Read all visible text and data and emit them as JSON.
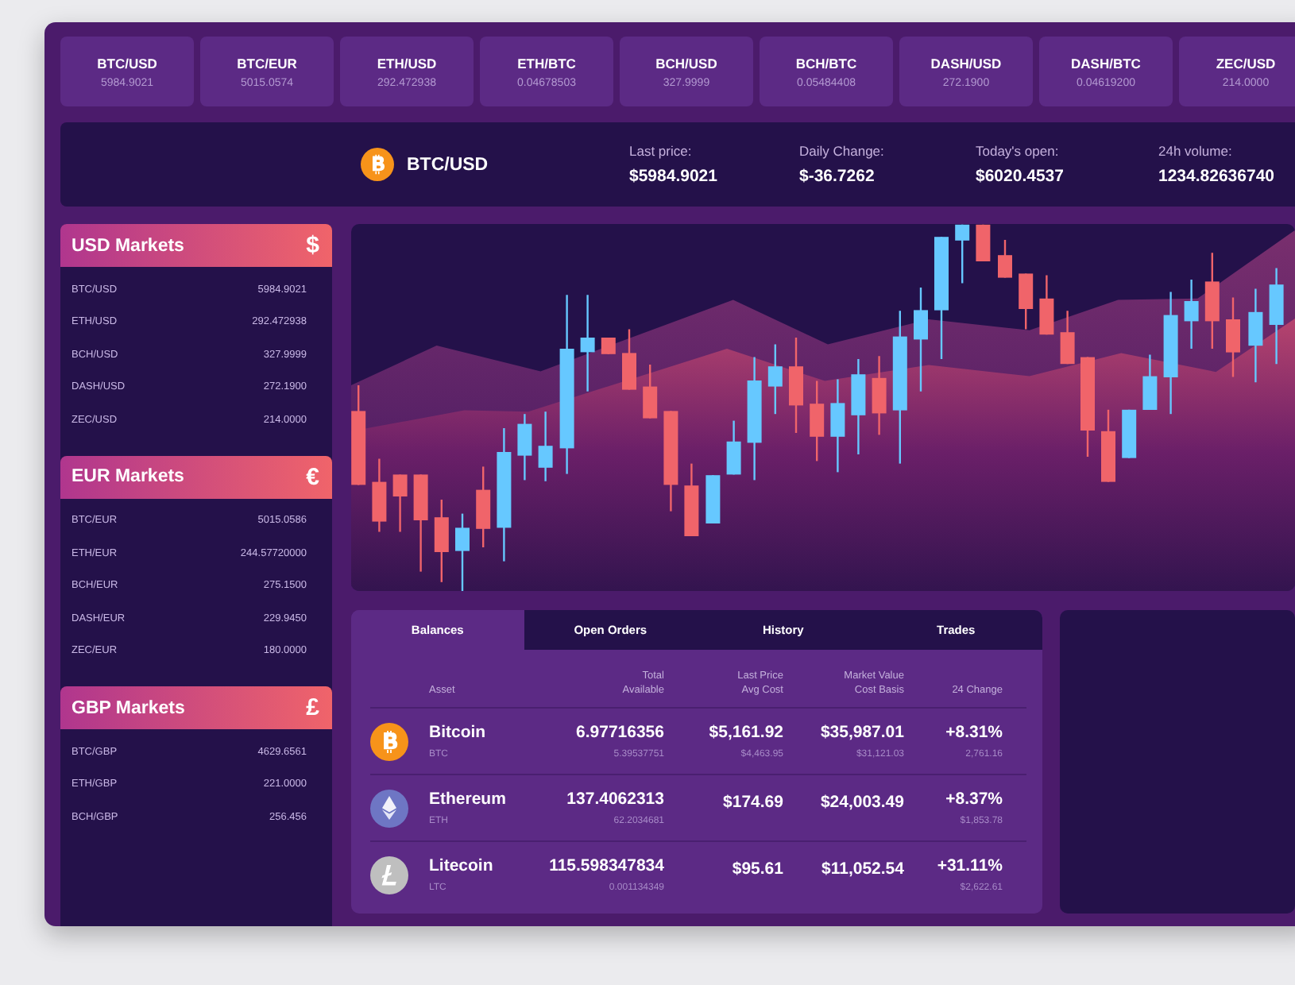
{
  "tickers": [
    {
      "pair": "BTC/USD",
      "price": "5984.9021"
    },
    {
      "pair": "BTC/EUR",
      "price": "5015.0574"
    },
    {
      "pair": "ETH/USD",
      "price": "292.472938"
    },
    {
      "pair": "ETH/BTC",
      "price": "0.04678503"
    },
    {
      "pair": "BCH/USD",
      "price": "327.9999"
    },
    {
      "pair": "BCH/BTC",
      "price": "0.05484408"
    },
    {
      "pair": "DASH/USD",
      "price": "272.1900"
    },
    {
      "pair": "DASH/BTC",
      "price": "0.04619200"
    },
    {
      "pair": "ZEC/USD",
      "price": "214.0000"
    }
  ],
  "header": {
    "kind": "btc",
    "pair": "BTC/USD",
    "stats": [
      {
        "label": "Last price:",
        "value": "$5984.9021"
      },
      {
        "label": "Daily Change:",
        "value": "$-36.7262"
      },
      {
        "label": "Today's open:",
        "value": "$6020.4537"
      },
      {
        "label": "24h volume:",
        "value": "1234.82636740"
      }
    ]
  },
  "markets": [
    {
      "title": "USD Markets",
      "symbol": "$",
      "rows": [
        {
          "pair": "BTC/USD",
          "price": "5984.9021"
        },
        {
          "pair": "ETH/USD",
          "price": "292.472938"
        },
        {
          "pair": "BCH/USD",
          "price": "327.9999"
        },
        {
          "pair": "DASH/USD",
          "price": "272.1900"
        },
        {
          "pair": "ZEC/USD",
          "price": "214.0000"
        }
      ]
    },
    {
      "title": "EUR Markets",
      "symbol": "€",
      "rows": [
        {
          "pair": "BTC/EUR",
          "price": "5015.0586"
        },
        {
          "pair": "ETH/EUR",
          "price": "244.57720000"
        },
        {
          "pair": "BCH/EUR",
          "price": "275.1500"
        },
        {
          "pair": "DASH/EUR",
          "price": "229.9450"
        },
        {
          "pair": "ZEC/EUR",
          "price": "180.0000"
        }
      ]
    },
    {
      "title": "GBP Markets",
      "symbol": "£",
      "rows": [
        {
          "pair": "BTC/GBP",
          "price": "4629.6561"
        },
        {
          "pair": "ETH/GBP",
          "price": "221.0000"
        },
        {
          "pair": "BCH/GBP",
          "price": "256.456"
        }
      ]
    }
  ],
  "balances": {
    "tabs": [
      {
        "label": "Balances",
        "selected": true
      },
      {
        "label": "Open Orders",
        "selected": false
      },
      {
        "label": "History",
        "selected": false
      },
      {
        "label": "Trades",
        "selected": false
      }
    ],
    "columns": [
      {
        "bottom": "Asset"
      },
      {
        "top": "Total",
        "bottom": "Available"
      },
      {
        "top": "Last Price",
        "bottom": "Avg Cost"
      },
      {
        "top": "Market Value",
        "bottom": "Cost Basis"
      },
      {
        "bottom": "24 Change"
      }
    ],
    "rows": [
      {
        "kind": "btc",
        "cells": [
          {
            "main": "Bitcoin",
            "sub": "BTC"
          },
          {
            "main": "6.97716356",
            "sub": "5.39537751"
          },
          {
            "main": "$5,161.92",
            "sub": "$4,463.95"
          },
          {
            "main": "$35,987.01",
            "sub": "$31,121.03"
          },
          {
            "main": "+8.31%",
            "sub": "2,761.16"
          }
        ]
      },
      {
        "kind": "eth",
        "cells": [
          {
            "main": "Ethereum",
            "sub": "ETH"
          },
          {
            "main": "137.4062313",
            "sub": "62.2034681"
          },
          {
            "main": "$174.69"
          },
          {
            "main": "$24,003.49"
          },
          {
            "main": "+8.37%",
            "sub": "$1,853.78"
          }
        ]
      },
      {
        "kind": "ltc",
        "cells": [
          {
            "main": "Litecoin",
            "sub": "LTC"
          },
          {
            "main": "115.598347834",
            "sub": "0.001134349"
          },
          {
            "main": "$95.61"
          },
          {
            "main": "$11,052.54"
          },
          {
            "main": "+31.11%",
            "sub": "$2,622.61"
          }
        ]
      }
    ]
  }
}
